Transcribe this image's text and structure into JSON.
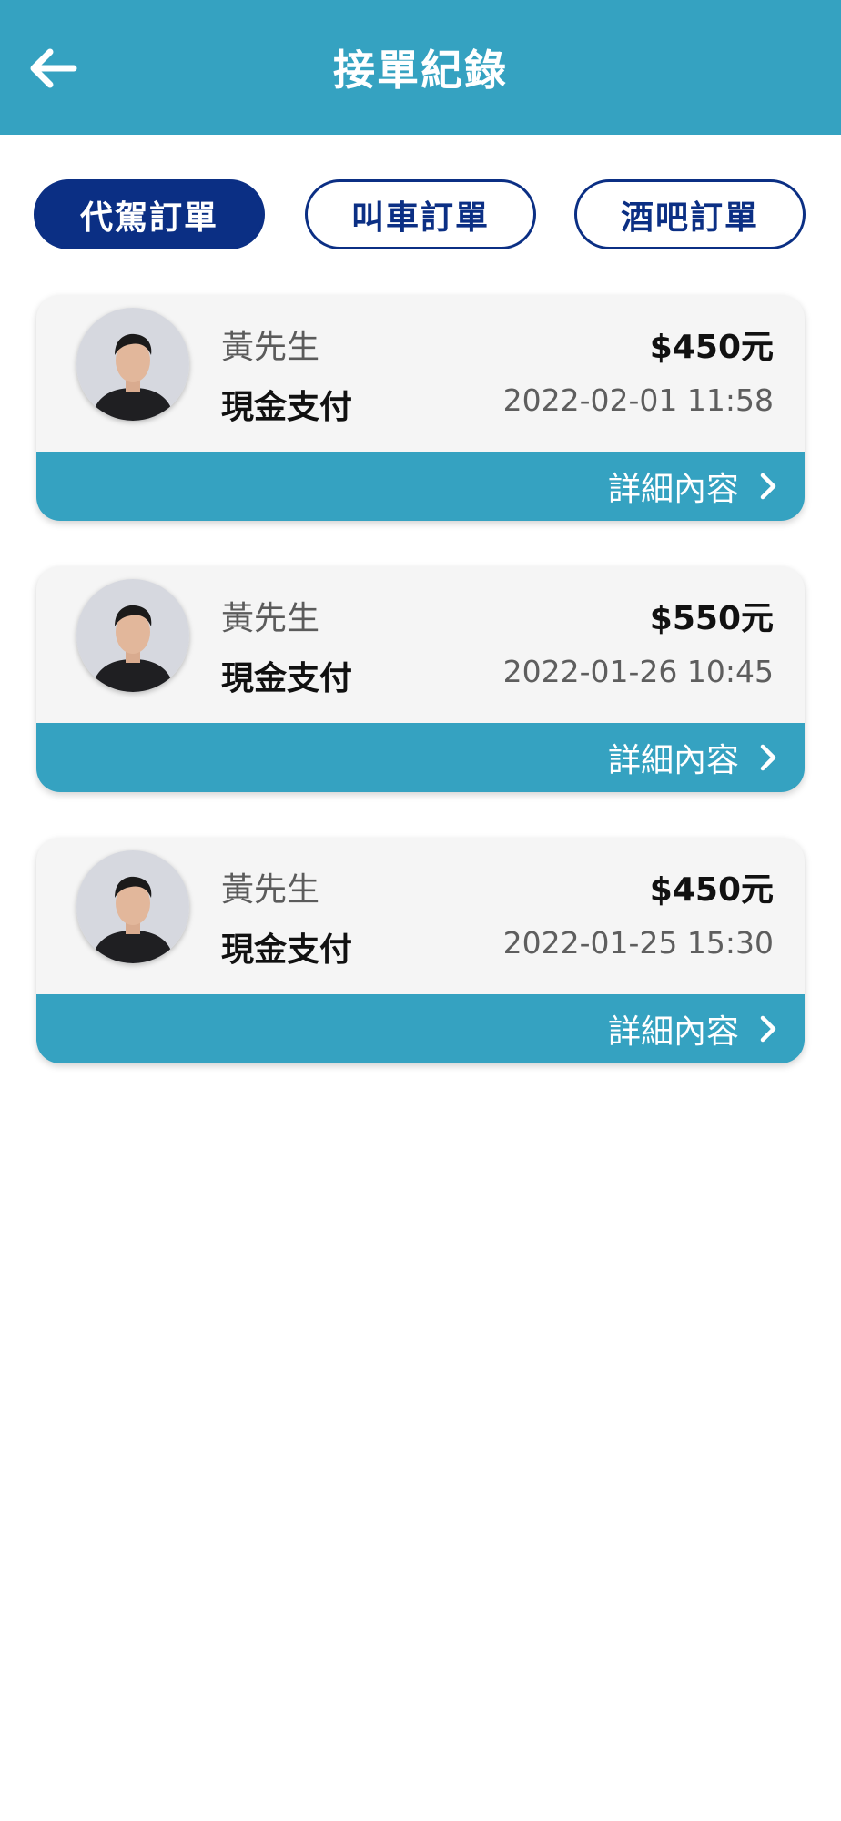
{
  "header": {
    "title": "接單紀錄",
    "back_icon": "arrow-left-icon"
  },
  "tabs": [
    {
      "label": "代駕訂單",
      "active": true
    },
    {
      "label": "叫車訂單",
      "active": false
    },
    {
      "label": "酒吧訂單",
      "active": false
    }
  ],
  "orders": [
    {
      "customer": "黃先生",
      "payment": "現金支付",
      "amount": "$450元",
      "datetime": "2022-02-01 11:58",
      "detail_label": "詳細內容"
    },
    {
      "customer": "黃先生",
      "payment": "現金支付",
      "amount": "$550元",
      "datetime": "2022-01-26 10:45",
      "detail_label": "詳細內容"
    },
    {
      "customer": "黃先生",
      "payment": "現金支付",
      "amount": "$450元",
      "datetime": "2022-01-25 15:30",
      "detail_label": "詳細內容"
    }
  ],
  "colors": {
    "header": "#35a2c1",
    "tab_accent": "#0b2f84",
    "card_bg": "#f5f5f5",
    "detail_bar": "#35a2c1"
  }
}
